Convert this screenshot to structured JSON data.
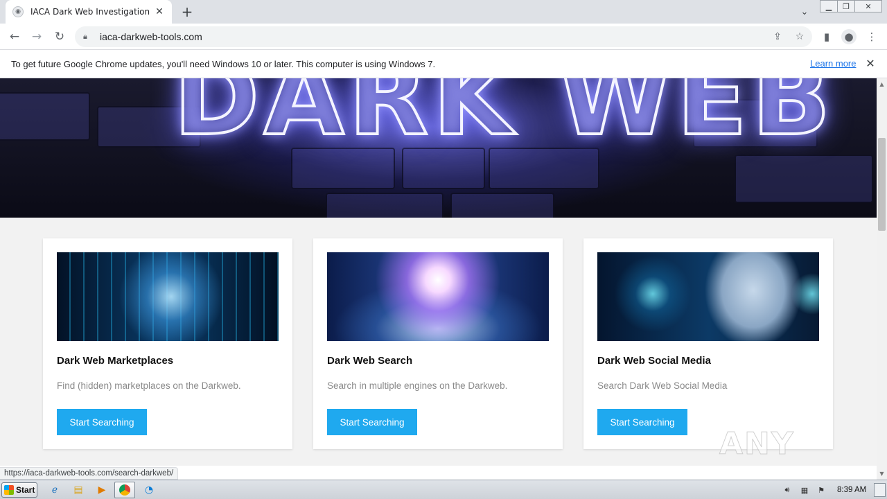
{
  "browser": {
    "tab": {
      "title": "IACA Dark Web Investigation Suppo",
      "favicon": "globe-icon",
      "close_icon": "close-icon"
    },
    "new_tab_icon": "plus-icon",
    "address": {
      "url": "iaca-darkweb-tools.com",
      "lock_icon": "lock-icon"
    },
    "toolbar_icons": [
      "back-icon",
      "forward-icon",
      "reload-icon",
      "share-icon",
      "star-icon",
      "side-panel-icon",
      "profile-icon",
      "menu-icon"
    ]
  },
  "infobar": {
    "message": "To get future Google Chrome updates, you'll need Windows 10 or later. This computer is using Windows 7.",
    "link": "Learn more",
    "link_color": "#1a73e8"
  },
  "hero": {
    "text": "DARK WEB"
  },
  "cards": [
    {
      "title": "Dark Web Marketplaces",
      "description": "Find (hidden) marketplaces on the Darkweb.",
      "button": "Start Searching"
    },
    {
      "title": "Dark Web Search",
      "description": "Search in multiple engines on the Darkweb.",
      "button": "Start Searching"
    },
    {
      "title": "Dark Web Social Media",
      "description": "Search Dark Web Social Media",
      "button": "Start Searching"
    }
  ],
  "button_color": "#1fa9ef",
  "status_url": "https://iaca-darkweb-tools.com/search-darkweb/",
  "watermark": "ANY RUN",
  "taskbar": {
    "start_label": "Start",
    "clock": "8:39 AM"
  }
}
